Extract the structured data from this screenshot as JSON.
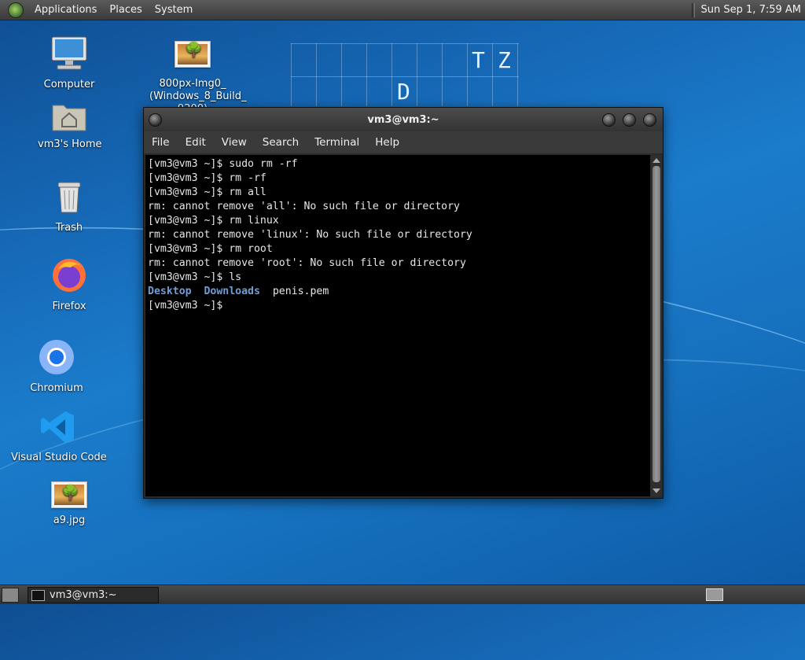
{
  "top_panel": {
    "menu": [
      "Applications",
      "Places",
      "System"
    ],
    "clock": "Sun Sep  1, 7:59 AM"
  },
  "wallpaper_letters": [
    "T",
    "Z",
    "D"
  ],
  "desktop_icons": [
    {
      "label": "Computer",
      "icon": "computer-icon"
    },
    {
      "label": "vm3's Home",
      "icon": "home-folder-icon"
    },
    {
      "label": "Trash",
      "icon": "trash-icon"
    },
    {
      "label": "Firefox",
      "icon": "firefox-icon"
    },
    {
      "label": "Chromium",
      "icon": "chromium-icon"
    },
    {
      "label": "Visual Studio Code",
      "icon": "vscode-icon"
    },
    {
      "label": "a9.jpg",
      "icon": "image-file-icon"
    },
    {
      "label_line1": "800px-Img0_",
      "label_line2": "(Windows_8_Build_",
      "label_line3": "9200)",
      "icon": "image-file-icon"
    }
  ],
  "terminal": {
    "title": "vm3@vm3:~",
    "menu": [
      "File",
      "Edit",
      "View",
      "Search",
      "Terminal",
      "Help"
    ],
    "lines": [
      "[vm3@vm3 ~]$ sudo rm -rf",
      "[vm3@vm3 ~]$ rm -rf",
      "[vm3@vm3 ~]$ rm all",
      "rm: cannot remove 'all': No such file or directory",
      "[vm3@vm3 ~]$ rm linux",
      "rm: cannot remove 'linux': No such file or directory",
      "[vm3@vm3 ~]$ rm root",
      "rm: cannot remove 'root': No such file or directory",
      "[vm3@vm3 ~]$ ls"
    ],
    "ls_output": {
      "dir1": "Desktop",
      "dir2": "Downloads",
      "file1": "penis.pem"
    },
    "prompt": "[vm3@vm3 ~]$"
  },
  "bottom_panel": {
    "task_label": "vm3@vm3:~"
  },
  "colors": {
    "dir_color": "#6f9ed6",
    "terminal_bg": "#000000"
  }
}
